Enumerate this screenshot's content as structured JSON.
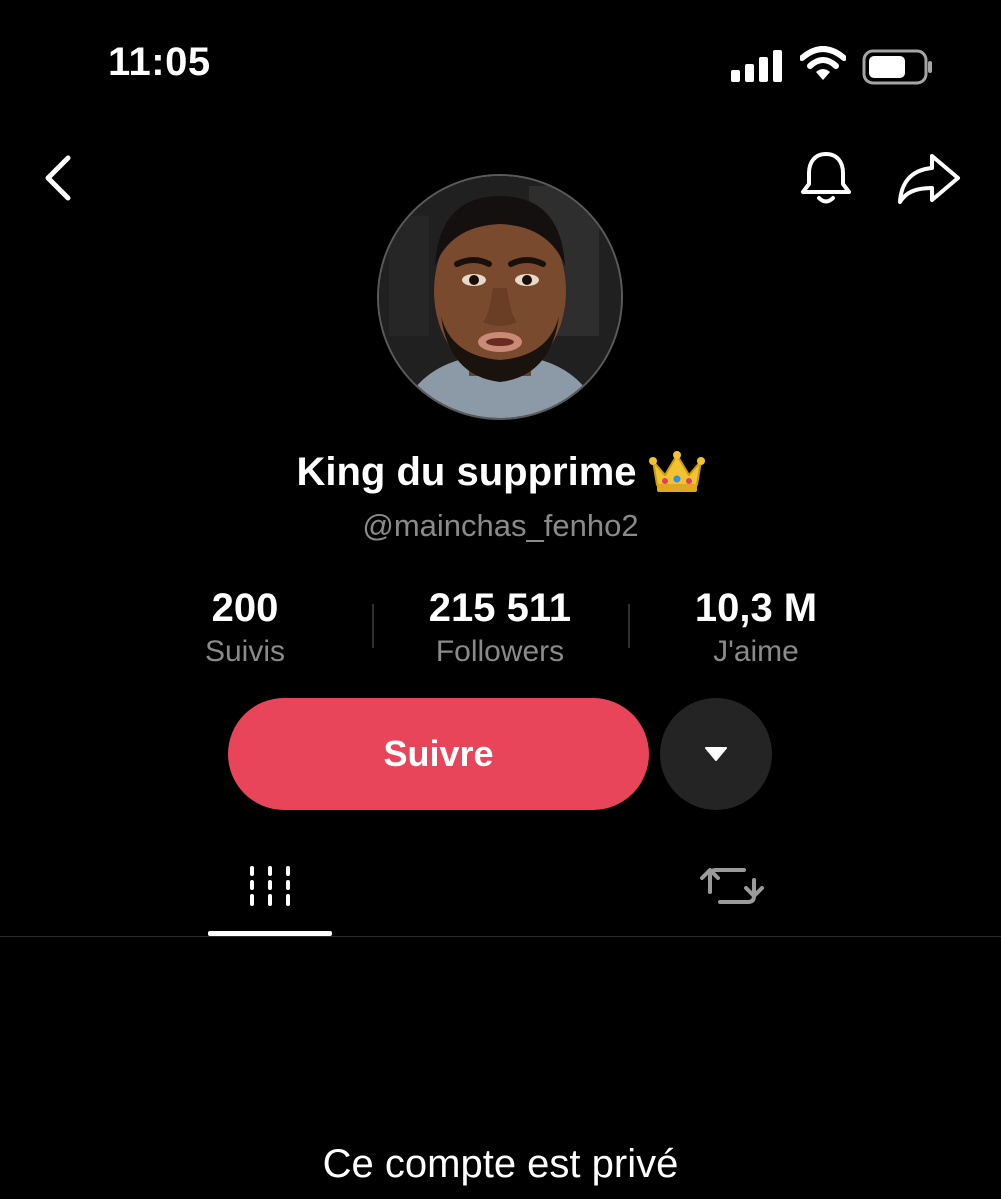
{
  "status_bar": {
    "time": "11:05",
    "icons": [
      "cellular-signal-icon",
      "wifi-icon",
      "battery-icon"
    ]
  },
  "header": {
    "icons": [
      "chevron-left-icon",
      "bell-icon",
      "share-arrow-icon"
    ]
  },
  "profile": {
    "display_name": "King du supprime",
    "name_emoji_icon": "crown-icon",
    "handle": "@mainchas_fenho2",
    "stats": [
      {
        "value": "200",
        "label": "Suivis"
      },
      {
        "value": "215 511",
        "label": "Followers"
      },
      {
        "value": "10,3 M",
        "label": "J'aime"
      }
    ]
  },
  "actions": {
    "follow_label": "Suivre",
    "more_icon": "caret-down-icon"
  },
  "tabs": [
    {
      "icon": "grid-videos-icon",
      "active": true
    },
    {
      "icon": "repost-icon",
      "active": false
    }
  ],
  "private_notice": "Ce compte est privé",
  "colors": {
    "background": "#000000",
    "follow_button": "#e8455b",
    "secondary_text": "#8a8a8a",
    "more_button": "#242424"
  }
}
